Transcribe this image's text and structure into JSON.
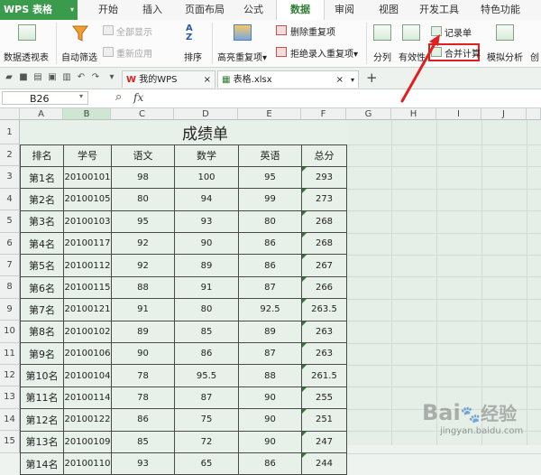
{
  "app": {
    "title": "WPS 表格",
    "caret": "▾"
  },
  "menu": {
    "tabs": [
      "开始",
      "插入",
      "页面布局",
      "公式",
      "数据",
      "审阅",
      "视图",
      "开发工具",
      "特色功能"
    ],
    "active": "数据"
  },
  "ribbon": {
    "pivot": "数据透视表",
    "autofilter": "自动筛选",
    "show_all": "全部显示",
    "reapply": "重新应用",
    "sort": "排序",
    "highlight_dup": "高亮重复项",
    "highlight_dup_caret": "▾",
    "delete_dup": "删除重复项",
    "reject_dup": "拒绝录入重复项",
    "reject_dup_caret": "▾",
    "split": "分列",
    "validity": "有效性",
    "record_form": "记录单",
    "consolidate": "合并计算",
    "simulate": "模拟分析",
    "cut_off": "创"
  },
  "doc_tabs": [
    {
      "label": "我的WPS"
    },
    {
      "label": "表格.xlsx"
    }
  ],
  "doc_close": "×",
  "doc_add": "+",
  "doc_menu": "▾",
  "formula_bar": {
    "cell_ref": "B26",
    "fx": "fx",
    "caret": "▾"
  },
  "columns": [
    "A",
    "B",
    "C",
    "D",
    "E",
    "F",
    "G",
    "H",
    "I",
    "J"
  ],
  "rows": [
    "1",
    "2",
    "3",
    "4",
    "5",
    "6",
    "7",
    "8",
    "9",
    "10",
    "11",
    "12",
    "13",
    "14",
    "15"
  ],
  "sheet": {
    "title": "成绩单",
    "headers": [
      "排名",
      "学号",
      "语文",
      "数学",
      "英语",
      "总分"
    ],
    "records": [
      [
        "第1名",
        "20100101",
        "98",
        "100",
        "95",
        "293"
      ],
      [
        "第2名",
        "20100105",
        "80",
        "94",
        "99",
        "273"
      ],
      [
        "第3名",
        "20100103",
        "95",
        "93",
        "80",
        "268"
      ],
      [
        "第4名",
        "20100117",
        "92",
        "90",
        "86",
        "268"
      ],
      [
        "第5名",
        "20100112",
        "92",
        "89",
        "86",
        "267"
      ],
      [
        "第6名",
        "20100115",
        "88",
        "91",
        "87",
        "266"
      ],
      [
        "第7名",
        "20100121",
        "91",
        "80",
        "92.5",
        "263.5"
      ],
      [
        "第8名",
        "20100102",
        "89",
        "85",
        "89",
        "263"
      ],
      [
        "第9名",
        "20100106",
        "90",
        "86",
        "87",
        "263"
      ],
      [
        "第10名",
        "20100104",
        "78",
        "95.5",
        "88",
        "261.5"
      ],
      [
        "第11名",
        "20100114",
        "78",
        "87",
        "90",
        "255"
      ],
      [
        "第12名",
        "20100122",
        "86",
        "75",
        "90",
        "251"
      ],
      [
        "第13名",
        "20100109",
        "85",
        "72",
        "90",
        "247"
      ],
      [
        "第14名",
        "20100110",
        "93",
        "65",
        "86",
        "244"
      ]
    ]
  },
  "watermark": {
    "brand": "Bai",
    "brand2": "经验",
    "url": "jingyan.baidu.com"
  },
  "colors": {
    "accent": "#3a9b4c",
    "highlight_box": "#e02020",
    "arrow": "#e02020",
    "grid_bg": "#e5efe8"
  }
}
